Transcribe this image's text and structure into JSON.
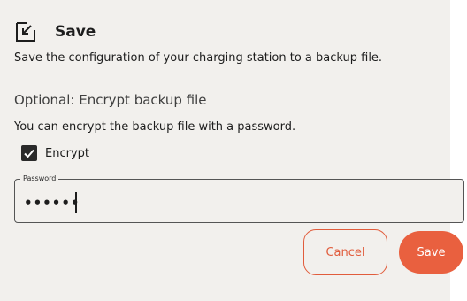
{
  "dialog": {
    "title": "Save",
    "title_icon": "save-to-file-icon",
    "subtitle": "Save the configuration of your charging station to a backup file."
  },
  "encryption": {
    "heading": "Optional: Encrypt backup file",
    "description": "You can encrypt the backup file with a password.",
    "checkbox_label": "Encrypt",
    "checked": true,
    "password_label": "Password",
    "password_masked": "••••••"
  },
  "buttons": {
    "cancel_label": "Cancel",
    "save_label": "Save"
  },
  "colors": {
    "panel_background": "#f2f0ed",
    "accent": "#e9603f",
    "text": "#1d1d1d"
  }
}
